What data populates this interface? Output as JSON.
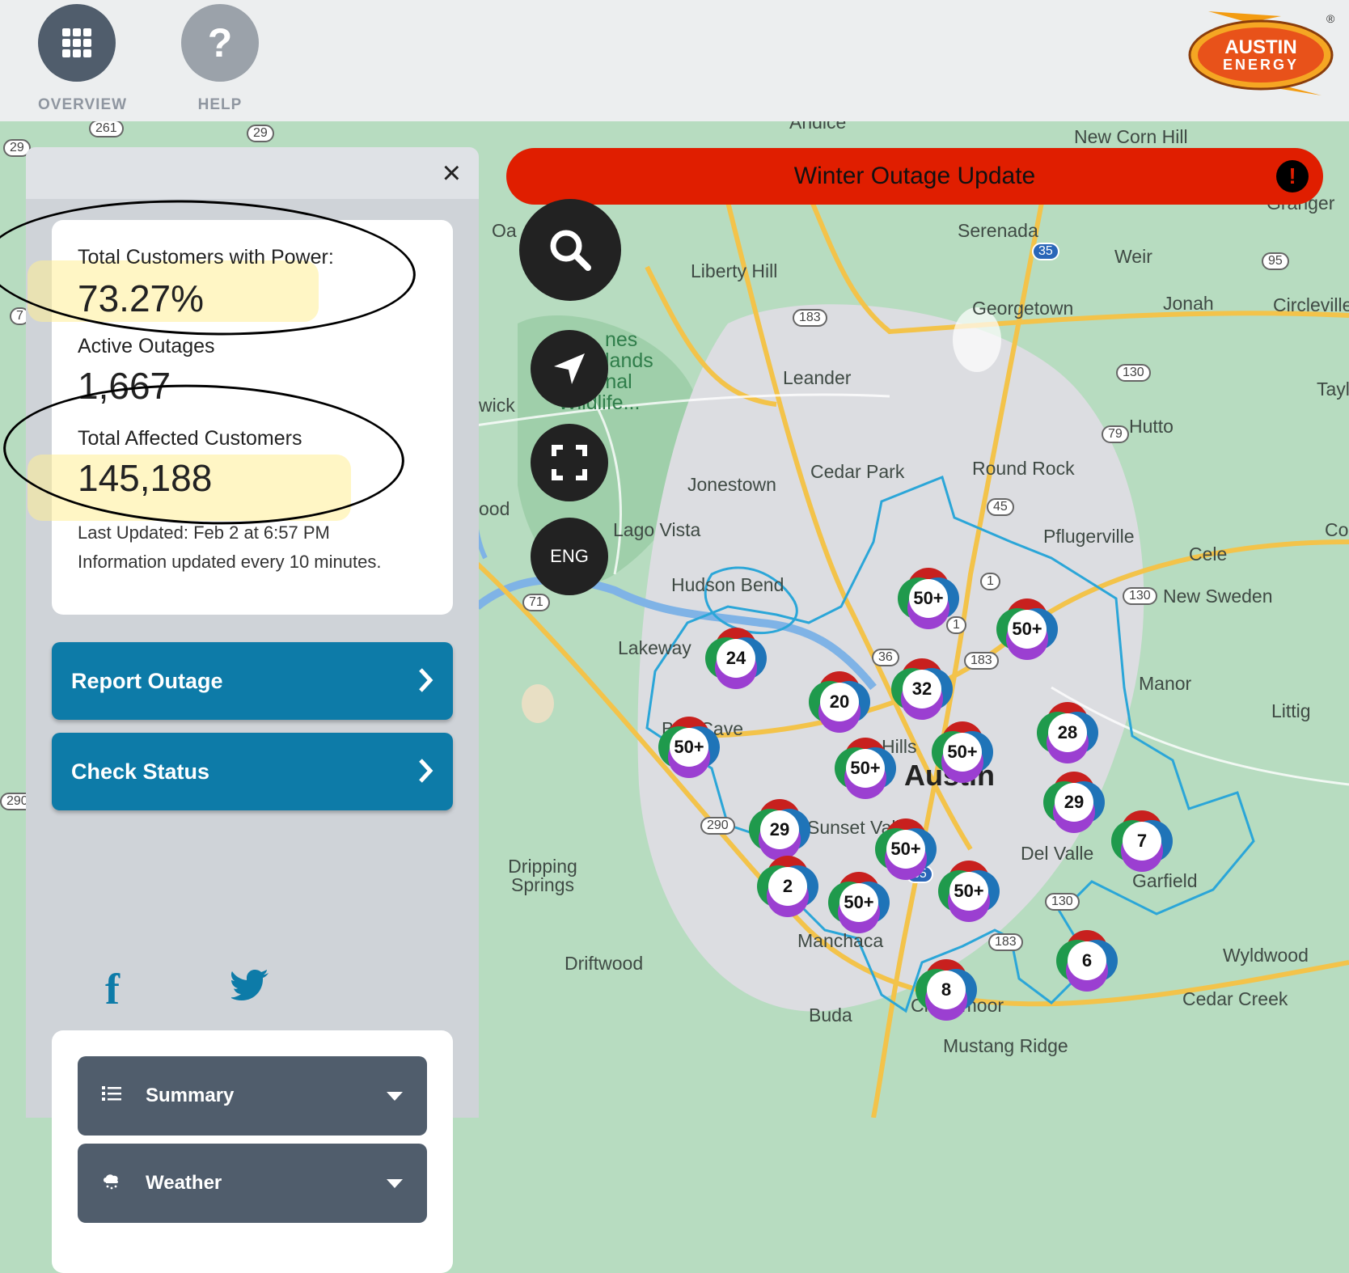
{
  "topbar": {
    "overview_label": "OVERVIEW",
    "help_label": "HELP",
    "help_glyph": "?",
    "logo_text_1": "AUSTIN",
    "logo_text_2": "ENERGY",
    "logo_reg": "®"
  },
  "alert": {
    "text": "Winter Outage Update",
    "icon": "!"
  },
  "map_controls": {
    "language": "ENG"
  },
  "panel": {
    "close": "×",
    "stats": {
      "with_power_label": "Total Customers with Power:",
      "with_power_value": "73.27%",
      "active_outages_label": "Active Outages",
      "active_outages_value": "1,667",
      "affected_label": "Total Affected Customers",
      "affected_value": "145,188",
      "last_updated": "Last Updated:  Feb 2 at 6:57 PM",
      "update_note": "Information updated every 10 minutes."
    },
    "report_outage": "Report Outage",
    "check_status": "Check Status",
    "social": {
      "facebook": "f"
    },
    "summary": "Summary",
    "weather": "Weather"
  },
  "map": {
    "places": [
      "Andice",
      "New Corn Hill",
      "Granger",
      "Serenada",
      "Weir",
      "Liberty Hill",
      "Georgetown",
      "Jonah",
      "Circleville",
      "Leander",
      "Taylor",
      "Hutto",
      "Cedar Park",
      "Round Rock",
      "Jonestown",
      "Lago Vista",
      "Pflugerville",
      "Cele",
      "Hudson Bend",
      "New Sweden",
      "Lakeway",
      "Manor",
      "Littig",
      "Bee Cave",
      "Hills",
      "Austin",
      "Sunset Valley",
      "Del Valle",
      "Garfield",
      "Dripping Springs",
      "Manchaca",
      "Driftwood",
      "Wyldwood",
      "Buda",
      "Creedmoor",
      "Cedar Creek",
      "Mustang Ridge",
      "Oa",
      "wick",
      "ood",
      "Co",
      "Taylor"
    ],
    "wildlife": [
      "nes",
      "lands",
      "National",
      "Wildlife..."
    ],
    "shields": [
      "261",
      "29",
      "29",
      "35",
      "95",
      "183",
      "130",
      "79",
      "45",
      "71",
      "130",
      "1",
      "183",
      "290",
      "290",
      "35",
      "183",
      "130",
      "1",
      "36",
      "7",
      "29"
    ],
    "clusters": [
      "50+",
      "50+",
      "24",
      "20",
      "32",
      "28",
      "50+",
      "50+",
      "50+",
      "29",
      "29",
      "7",
      "50+",
      "2",
      "50+",
      "50+",
      "6",
      "8"
    ]
  },
  "colors": {
    "alert": "#e01e00",
    "action_blue": "#0d7ba8",
    "dropdown": "#505d6c",
    "nav_circle_dark": "#505d6c",
    "nav_circle_light": "#9ba2aa"
  }
}
